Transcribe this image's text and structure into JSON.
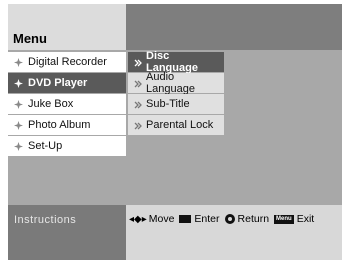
{
  "header": {
    "title": "Menu"
  },
  "left_menu": {
    "items": [
      {
        "label": "Digital Recorder",
        "active": false
      },
      {
        "label": "DVD Player",
        "active": true
      },
      {
        "label": "Juke Box",
        "active": false
      },
      {
        "label": "Photo Album",
        "active": false
      },
      {
        "label": "Set-Up",
        "active": false
      }
    ]
  },
  "sub_menu": {
    "items": [
      {
        "label": "Disc Language",
        "active": true
      },
      {
        "label": "Audio Language",
        "active": false
      },
      {
        "label": "Sub-Title",
        "active": false
      },
      {
        "label": "Parental Lock",
        "active": false
      }
    ]
  },
  "instructions": {
    "label": "Instructions",
    "move_glyph": "◂◆▸",
    "move": "Move",
    "enter": "Enter",
    "return": "Return",
    "menu_key": "Menu",
    "exit": "Exit"
  },
  "colors": {
    "header_left": "#dcdcdc",
    "header_right": "#7e7e7e",
    "panel": "#a8a8a8",
    "active": "#5a5a5a",
    "instructions_left": "#7a7a7a",
    "instructions_right": "#d8d8d8"
  }
}
